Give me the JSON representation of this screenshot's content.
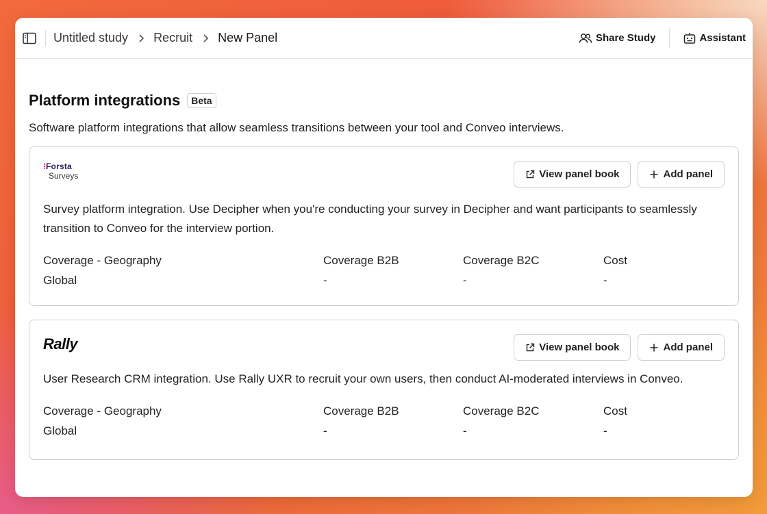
{
  "breadcrumb": [
    "Untitled study",
    "Recruit",
    "New Panel"
  ],
  "header_actions": {
    "share_label": "Share Study",
    "assistant_label": "Assistant"
  },
  "section": {
    "title": "Platform integrations",
    "badge": "Beta",
    "description": "Software platform integrations that allow seamless transitions between your tool and Conveo interviews."
  },
  "integrations": [
    {
      "logo": {
        "brand": "Forsta",
        "sub": "Surveys"
      },
      "view_label": "View panel book",
      "add_label": "Add panel",
      "description": "Survey platform integration. Use Decipher when you're conducting your survey in Decipher and want participants to seamlessly transition to Conveo for the interview portion.",
      "coverage": {
        "headers": [
          "Coverage - Geography",
          "Coverage B2B",
          "Coverage B2C",
          "Cost"
        ],
        "values": [
          "Global",
          "-",
          "-",
          "-"
        ]
      }
    },
    {
      "logo": {
        "brand": "Rally"
      },
      "view_label": "View panel book",
      "add_label": "Add panel",
      "description": "User Research CRM integration. Use Rally UXR to recruit your own users, then conduct AI-moderated interviews in Conveo.",
      "coverage": {
        "headers": [
          "Coverage - Geography",
          "Coverage B2B",
          "Coverage B2C",
          "Cost"
        ],
        "values": [
          "Global",
          "-",
          "-",
          "-"
        ]
      }
    }
  ],
  "icons": {
    "sidebar_toggle": "sidebar-toggle-icon",
    "chevron": "chevron-right-icon",
    "share": "users-icon",
    "assistant": "assistant-icon",
    "external_link": "external-link-icon",
    "plus": "plus-icon"
  }
}
